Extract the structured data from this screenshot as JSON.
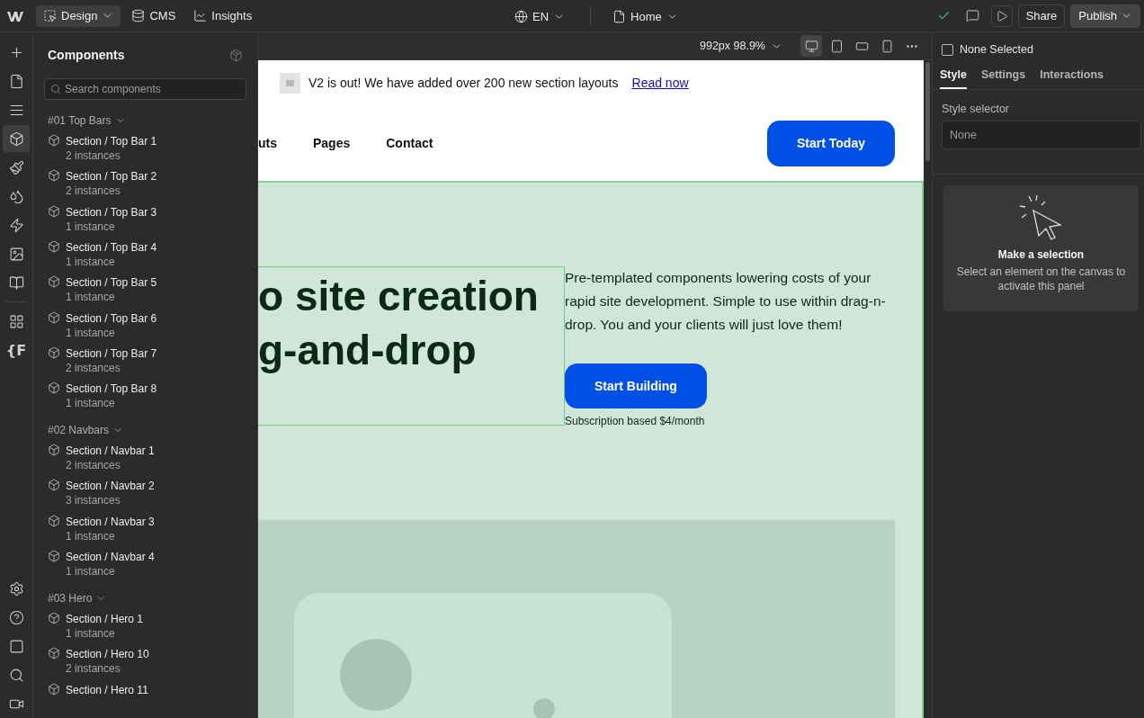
{
  "topbar": {
    "modes": [
      {
        "label": "Design",
        "selected": true
      },
      {
        "label": "CMS",
        "selected": false
      },
      {
        "label": "Insights",
        "selected": false
      }
    ],
    "locale": "EN",
    "page": "Home",
    "share": "Share",
    "publish": "Publish"
  },
  "rail": {
    "top": [
      {
        "selected": false
      },
      {
        "selected": false
      },
      {
        "selected": false
      },
      {
        "selected": true
      },
      {
        "selected": false
      },
      {
        "selected": false
      },
      {
        "selected": false
      },
      {
        "selected": false
      },
      {
        "selected": false
      }
    ],
    "apps": [
      {
        "selected": false
      },
      {
        "label": "{F",
        "selected": false
      }
    ],
    "bottom": [
      {
        "selected": false
      },
      {
        "selected": false
      },
      {
        "selected": false
      },
      {
        "selected": false
      },
      {
        "selected": false
      }
    ]
  },
  "components_panel": {
    "title": "Components",
    "search": {
      "placeholder": "Search components"
    },
    "groups": [
      {
        "name": "#01 Top Bars",
        "expanded": true,
        "items": [
          {
            "name": "Section / Top Bar 1",
            "count": "2 instances"
          },
          {
            "name": "Section / Top Bar 2",
            "count": "2 instances"
          },
          {
            "name": "Section / Top Bar 3",
            "count": "1 instance"
          },
          {
            "name": "Section / Top Bar 4",
            "count": "1 instance"
          },
          {
            "name": "Section / Top Bar 5",
            "count": "1 instance"
          },
          {
            "name": "Section / Top Bar 6",
            "count": "1 instance"
          },
          {
            "name": "Section / Top Bar 7",
            "count": "2 instances"
          },
          {
            "name": "Section / Top Bar 8",
            "count": "1 instance"
          }
        ]
      },
      {
        "name": "#02 Navbars",
        "expanded": true,
        "items": [
          {
            "name": "Section / Navbar 1",
            "count": "2 instances"
          },
          {
            "name": "Section / Navbar 2",
            "count": "3 instances"
          },
          {
            "name": "Section / Navbar 3",
            "count": "1 instance"
          },
          {
            "name": "Section / Navbar 4",
            "count": "1 instance"
          }
        ]
      },
      {
        "name": "#03 Hero",
        "expanded": true,
        "items": [
          {
            "name": "Section / Hero 1",
            "count": "1 instance"
          },
          {
            "name": "Section / Hero 10",
            "count": "2 instances"
          },
          {
            "name": "Section / Hero 11"
          }
        ]
      }
    ]
  },
  "canvas_toolbar": {
    "size": "992px 98.9%",
    "breakpoints": [
      {
        "selected": true
      },
      {
        "selected": false
      },
      {
        "selected": false
      },
      {
        "selected": false
      }
    ]
  },
  "canvas": {
    "announcement": {
      "text": "V2 is out! We have added over 200 new section layouts",
      "link": "Read now"
    },
    "nav_links": [
      "uts",
      "Pages",
      "Contact"
    ],
    "nav_button": "Start Today",
    "hero": {
      "heading_lines": [
        "o site creation",
        "g-and-drop"
      ],
      "paragraph": "Pre-templated components lowering costs of your rapid site development. Simple to use within drag-n-drop. You and your clients will just love them!",
      "button": "Start Building",
      "note": "Subscription based $4/month"
    }
  },
  "right_panel": {
    "selection": {
      "label": "None Selected",
      "checked": false
    },
    "tabs": [
      {
        "label": "Style",
        "selected": true
      },
      {
        "label": "Settings",
        "selected": false
      },
      {
        "label": "Interactions",
        "selected": false
      }
    ],
    "style_selector": {
      "label": "Style selector",
      "placeholder": "None"
    },
    "empty_state": {
      "title": "Make a selection",
      "text": "Select an element on the canvas to activate this panel"
    }
  }
}
